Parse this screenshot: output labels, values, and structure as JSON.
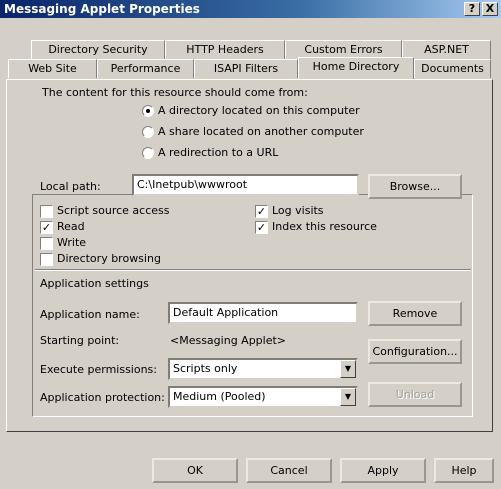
{
  "window": {
    "title": "Messaging Applet Properties",
    "help_button": "?",
    "close_button": "X"
  },
  "tabs_row1": [
    "Directory Security",
    "HTTP Headers",
    "Custom Errors",
    "ASP.NET"
  ],
  "tabs_row2": [
    "Web Site",
    "Performance",
    "ISAPI Filters",
    "Home Directory",
    "Documents"
  ],
  "active_tab": "Home Directory",
  "source": {
    "heading": "The content for this resource should come from:",
    "options": [
      {
        "label": "A directory located on this computer",
        "selected": true
      },
      {
        "label": "A share located on another computer",
        "selected": false
      },
      {
        "label": "A redirection to a URL",
        "selected": false
      }
    ]
  },
  "local_path": {
    "label": "Local path:",
    "value": "C:\\Inetpub\\wwwroot",
    "browse_button": "Browse..."
  },
  "permissions": {
    "script_source_access": {
      "label": "Script source access",
      "checked": false
    },
    "read": {
      "label": "Read",
      "checked": true
    },
    "write": {
      "label": "Write",
      "checked": false
    },
    "directory_browsing": {
      "label": "Directory browsing",
      "checked": false
    },
    "log_visits": {
      "label": "Log visits",
      "checked": true
    },
    "index_resource": {
      "label": "Index this resource",
      "checked": true
    }
  },
  "app_settings": {
    "heading": "Application settings",
    "name_label": "Application name:",
    "name_value": "Default Application",
    "remove_button": "Remove",
    "starting_point_label": "Starting point:",
    "starting_point_value": "<Messaging Applet>",
    "configuration_button": "Configuration...",
    "execute_label": "Execute permissions:",
    "execute_value": "Scripts only",
    "protection_label": "Application protection:",
    "protection_value": "Medium (Pooled)",
    "unload_button": "Unload"
  },
  "footer": {
    "ok": "OK",
    "cancel": "Cancel",
    "apply": "Apply",
    "help": "Help"
  }
}
